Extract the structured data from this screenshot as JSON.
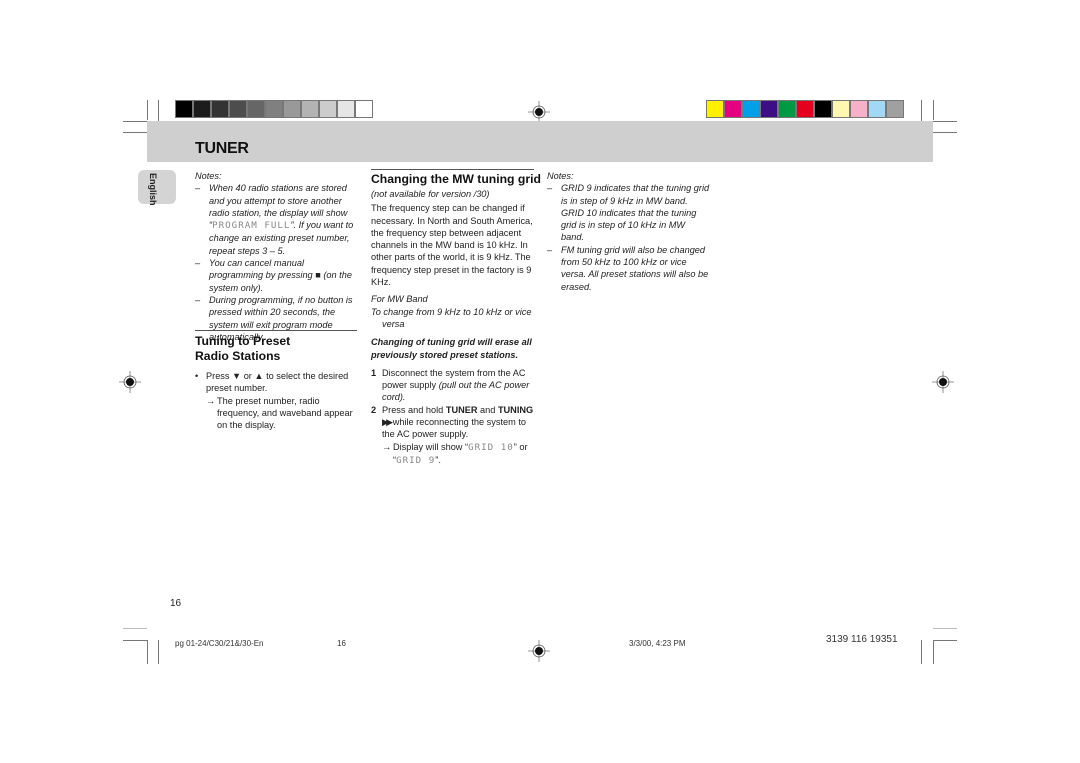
{
  "color_bars": {
    "grayscale": [
      "#000000",
      "#1c1c1c",
      "#333333",
      "#4d4d4d",
      "#666666",
      "#808080",
      "#999999",
      "#b3b3b3",
      "#cccccc",
      "#e6e6e6",
      "#ffffff"
    ],
    "process": [
      "#ffef00",
      "#e4007f",
      "#00a0e9",
      "#3b0f83",
      "#009944",
      "#e60020",
      "#000000",
      "#fff7b0",
      "#f6b0c8",
      "#a0d8f5",
      "#a0a0a0"
    ]
  },
  "header": {
    "title": "TUNER",
    "band_color": "#cfcfcf"
  },
  "language_tab": {
    "label": "English"
  },
  "left_column": {
    "notes_title": "Notes:",
    "notes": [
      {
        "dash": "–",
        "before": "When 40 radio stations are stored and you attempt to store another radio station, the display will show “",
        "lcd": "PROGRAM FULL",
        "after": "”. If you want to change an existing preset number, repeat steps 3 – 5."
      },
      {
        "dash": "–",
        "before": "You can cancel manual programming by pressing ",
        "icon": "■",
        "after": " (on the system only)."
      },
      {
        "dash": "–",
        "text": "During programming,  if no button is pressed within 20 seconds, the system will exit program mode automatically."
      }
    ],
    "section_title": "Tuning to Preset Radio Stations",
    "bullet": {
      "dot": "•",
      "before": "Press ",
      "down_icon": "▼",
      "middle": " or ",
      "up_icon": "▲",
      "after": " to select the desired preset number."
    },
    "result": {
      "arrow": "→",
      "text": "The preset number, radio frequency, and waveband appear on the display."
    }
  },
  "middle_column": {
    "section_title": "Changing the MW tuning grid",
    "availability": "(not available for version /30)",
    "body": "The frequency step can be changed if necessary. In North and South America, the frequency step between adjacent channels in the MW band is 10 kHz. In other parts of the world, it is 9 kHz. The frequency step preset in the factory is 9 KHz.",
    "band_label": "For MW Band",
    "band_instruction": "To change from 9 kHz to 10 kHz or vice versa",
    "warning": "Changing of tuning grid will erase all previously stored preset stations.",
    "steps": [
      {
        "num": "1",
        "text": "Disconnect the system from the AC power supply ",
        "italic": "(pull out the AC power cord)."
      },
      {
        "num": "2",
        "before": "Press and hold ",
        "key1": "TUNER",
        "and": " and ",
        "key2": "TUNING",
        "icon": "▶▶",
        "after": " while reconnecting the system to the AC power supply."
      }
    ],
    "result": {
      "arrow": "→",
      "before": "Display will show “",
      "lcd1": "GRID 10",
      "middle": "” or “",
      "lcd2": "GRID 9",
      "after": "”."
    }
  },
  "right_column": {
    "notes_title": "Notes:",
    "notes": [
      {
        "dash": "–",
        "text": "GRID 9 indicates that the tuning grid is in step of 9 kHz in MW band. GRID 10 indicates that the tuning grid is in step of 10 kHz in MW band."
      },
      {
        "dash": "–",
        "text": "FM tuning grid will also be changed from 50 kHz to 100 kHz or vice versa. All preset stations will also be erased."
      }
    ]
  },
  "page_number": "16",
  "footer": {
    "file": "pg 01-24/C30/21&/30-En",
    "page": "16",
    "date": "3/3/00, 4:23 PM",
    "code": "3139 116 19351"
  }
}
